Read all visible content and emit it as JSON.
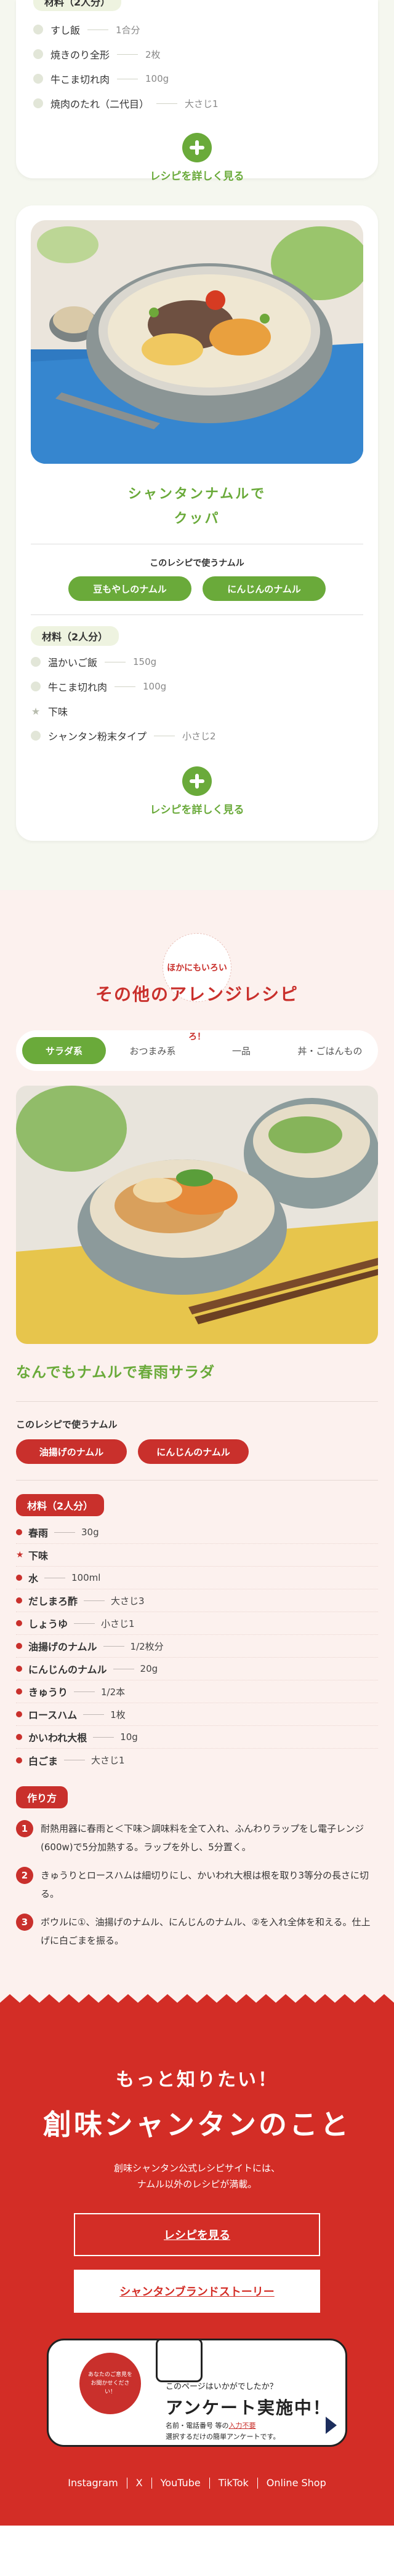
{
  "card1": {
    "materials_label": "材料（2人分）",
    "ingredients": [
      {
        "name": "すし飯",
        "amount": "1合分"
      },
      {
        "name": "焼きのり全形",
        "amount": "2枚"
      },
      {
        "name": "牛こま切れ肉",
        "amount": "100g"
      },
      {
        "name": "焼肉のたれ（二代目）",
        "amount": "大さじ1"
      }
    ],
    "detail_link": "レシピを詳しく見る"
  },
  "card2": {
    "title_line1": "シャンタンナムルで",
    "title_line2": "クッパ",
    "uses_label": "このレシピで使うナムル",
    "namul": [
      "豆もやしのナムル",
      "にんじんのナムル"
    ],
    "materials_label": "材料（2人分）",
    "ingredients": [
      {
        "type": "dot",
        "name": "温かいご飯",
        "amount": "150g"
      },
      {
        "type": "dot",
        "name": "牛こま切れ肉",
        "amount": "100g"
      },
      {
        "type": "star",
        "name": "下味",
        "amount": ""
      },
      {
        "type": "dot",
        "name": "シャンタン粉末タイプ",
        "amount": "小さじ2"
      }
    ],
    "detail_link": "レシピを詳しく見る"
  },
  "arrange": {
    "badge": "ほかにもいろいろ！",
    "title": "その他のアレンジレシピ",
    "tabs": [
      "サラダ系",
      "おつまみ系",
      "一品",
      "丼・ごはんもの"
    ],
    "active_tab": 0,
    "recipe_title": "なんでもナムルで春雨サラダ",
    "uses_label": "このレシピで使うナムル",
    "namul": [
      "油揚げのナムル",
      "にんじんのナムル"
    ],
    "materials_label": "材料（2人分）",
    "ingredients": [
      {
        "type": "dot",
        "name": "春雨",
        "amount": "30g"
      },
      {
        "type": "star",
        "name": "下味",
        "amount": ""
      },
      {
        "type": "dot",
        "name": "水",
        "amount": "100ml"
      },
      {
        "type": "dot",
        "name": "だしまろ酢",
        "amount": "大さじ3"
      },
      {
        "type": "dot",
        "name": "しょうゆ",
        "amount": "小さじ1"
      },
      {
        "type": "dot",
        "name": "油揚げのナムル",
        "amount": "1/2枚分"
      },
      {
        "type": "dot",
        "name": "にんじんのナムル",
        "amount": "20g"
      },
      {
        "type": "dot",
        "name": "きゅうり",
        "amount": "1/2本"
      },
      {
        "type": "dot",
        "name": "ロースハム",
        "amount": "1枚"
      },
      {
        "type": "dot",
        "name": "かいわれ大根",
        "amount": "10g"
      },
      {
        "type": "dot",
        "name": "白ごま",
        "amount": "大さじ1"
      }
    ],
    "steps_label": "作り方",
    "steps": [
      {
        "num": "1",
        "text": "耐熱用器に春雨と＜下味＞調味料を全て入れ、ふんわりラップをし電子レンジ(600w)で5分加熱する。ラップを外し、5分置く。"
      },
      {
        "num": "2",
        "text": "きゅうりとロースハムは細切りにし、かいわれ大根は根を取り3等分の長さに切る。"
      },
      {
        "num": "3",
        "text": "ボウルに①、油揚げのナムル、にんじんのナムル、②を入れ全体を和える。仕上げに白ごまを振る。"
      }
    ]
  },
  "footer": {
    "motto": "もっと知りたい！",
    "brand": "創味シャンタンのこと",
    "desc_line1": "創味シャンタン公式レシピサイトには、",
    "desc_line2": "ナムル以外のレシピが満載。",
    "btn_recipe": "レシピを見る",
    "btn_story": "シャンタンブランドストーリー",
    "survey": {
      "bubble": "あなたのご意見を お聞かせください！",
      "question": "このページはいかがでしたか？",
      "title": "アンケート実施中！",
      "note_line1_pre": "名前・電話番号 等の",
      "note_line1_link": "入力不要",
      "note_line2": "選択するだけの簡単アンケートです。"
    },
    "social": [
      "Instagram",
      "X",
      "YouTube",
      "TikTok",
      "Online Shop"
    ]
  },
  "colors": {
    "green": "#6aaa3a",
    "red": "#c9302c",
    "red_bg": "#d32d26",
    "pink_bg": "#fcf1ee",
    "green_bg": "#f5f7ef"
  }
}
